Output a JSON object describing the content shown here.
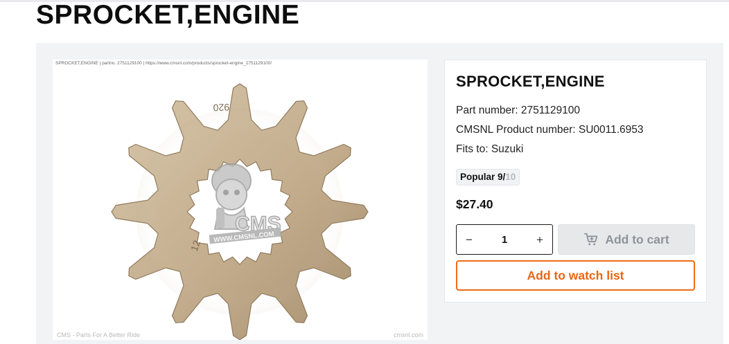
{
  "page": {
    "title": "SPROCKET,ENGINE"
  },
  "image": {
    "caption": "SPROCKET,ENGINE | partno. 2751129100  | https://www.cmsnl.com/products/sprocket-engine_2751129100/",
    "footer_left": "CMS - Parts For A Better Ride",
    "footer_right": "cmsnl.com",
    "stamp_top": "920",
    "stamp_bottom": "12",
    "watermark_text": "CMS",
    "watermark_url": "WWW.CMSNL.COM"
  },
  "product": {
    "name": "SPROCKET,ENGINE",
    "part_number": "Part number: 2751129100",
    "cmsnl_number": "CMSNL Product number: SU0011.6953",
    "fits_to": "Fits to: Suzuki",
    "popular_label": "Popular 9/",
    "popular_max": "10",
    "price": "$27.40"
  },
  "cart": {
    "minus_label": "−",
    "quantity": "1",
    "plus_label": "+",
    "icon": "cart-icon",
    "add_to_cart_label": "Add to cart",
    "add_to_watch_label": "Add to watch list"
  },
  "colors": {
    "accent_orange": "#ee6b17",
    "panel_bg": "#f2f3f5",
    "disabled_btn_bg": "#e6e8ea",
    "sprocket_metal": "#c2ad8f"
  }
}
